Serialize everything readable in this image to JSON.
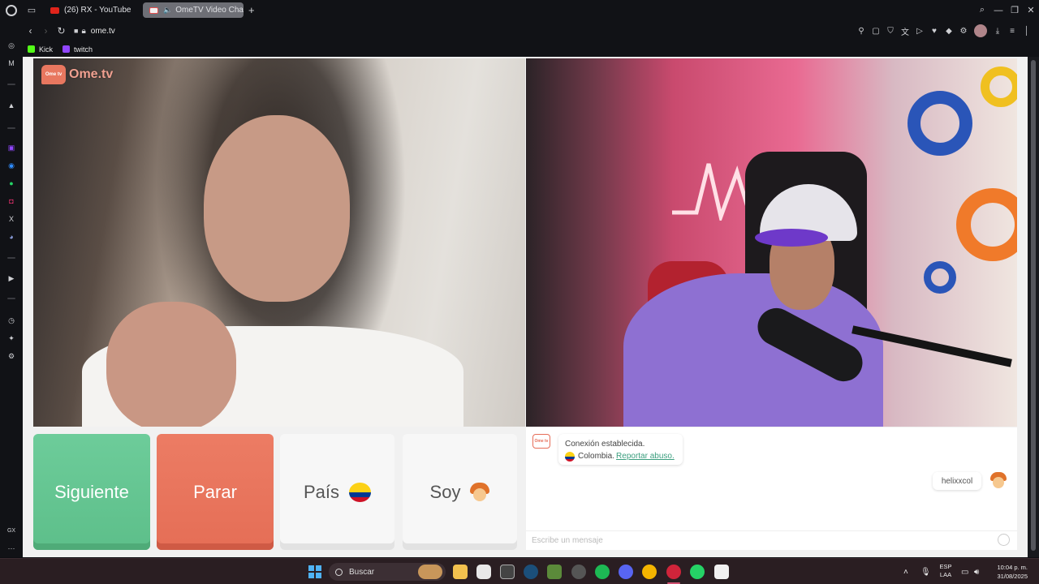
{
  "browser": {
    "tabs": [
      {
        "label": "(26) RX - YouTube",
        "active": false
      },
      {
        "label": "OmeTV Video Chat -...",
        "active": true
      }
    ],
    "url": "ome.tv",
    "bookmarks": [
      {
        "label": "Kick",
        "icon": "kick-icon",
        "color": "#53fc18"
      },
      {
        "label": "twitch",
        "icon": "twitch-icon",
        "color": "#9146ff"
      }
    ]
  },
  "ometv": {
    "logo_text": "Ome.tv",
    "logo_badge": "Ome tv",
    "buttons": {
      "next": "Siguiente",
      "stop": "Parar",
      "country": "País",
      "soy": "Soy"
    },
    "chat": {
      "system_line1": "Conexión establecida.",
      "system_country": "Colombia.",
      "system_report": "Reportar abuso.",
      "user_message": "helixxcol",
      "input_placeholder": "Escribe un mensaje"
    },
    "colors": {
      "next": "#5dbf8a",
      "stop": "#e56e56",
      "link": "#3b9e7e"
    }
  },
  "taskbar": {
    "search_label": "Buscar",
    "lang_line1": "ESP",
    "lang_line2": "LAA",
    "time": "10:04 p. m.",
    "date": "31/08/2025"
  }
}
